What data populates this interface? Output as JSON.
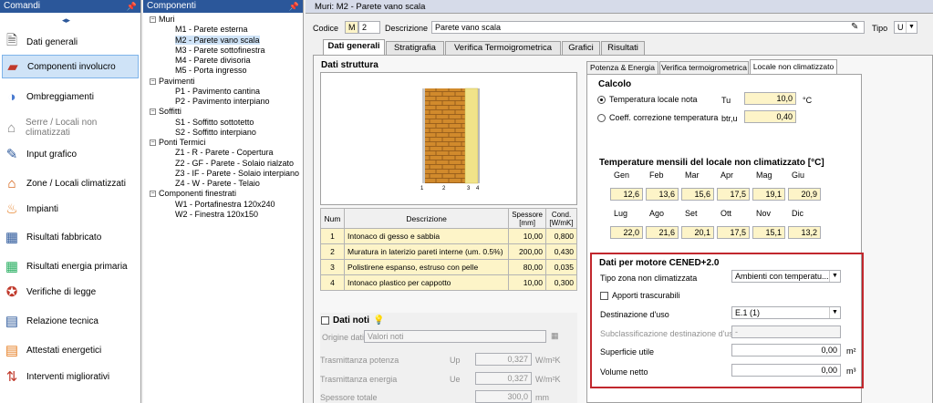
{
  "left": {
    "title": "Comandi",
    "items": [
      {
        "label": "Dati generali",
        "icon": "document-icon"
      },
      {
        "label": "Componenti involucro",
        "icon": "wall-icon"
      },
      {
        "label": "Ombreggiamenti",
        "icon": "shade-icon"
      },
      {
        "label": "Serre / Locali non climatizzati",
        "icon": "greenhouse-icon"
      },
      {
        "label": "Input grafico",
        "icon": "graph-icon"
      },
      {
        "label": "Zone / Locali climatizzati",
        "icon": "house-icon"
      },
      {
        "label": "Impianti",
        "icon": "flame-icon"
      },
      {
        "label": "Risultati fabbricato",
        "icon": "calculator-icon"
      },
      {
        "label": "Risultati energia primaria",
        "icon": "calculator-green-icon"
      },
      {
        "label": "Verifiche di legge",
        "icon": "star-icon"
      },
      {
        "label": "Relazione tecnica",
        "icon": "report-icon"
      },
      {
        "label": "Attestati energetici",
        "icon": "energy-bars-icon"
      },
      {
        "label": "Interventi migliorativi",
        "icon": "improve-icon"
      }
    ]
  },
  "tree": {
    "title": "Componenti",
    "nodes": [
      {
        "label": "Muri",
        "level": 0
      },
      {
        "label": "M1 - Parete esterna",
        "level": 1
      },
      {
        "label": "M2 - Parete vano scala",
        "level": 1
      },
      {
        "label": "M3 - Parete sottofinestra",
        "level": 1
      },
      {
        "label": "M4 - Parete divisoria",
        "level": 1
      },
      {
        "label": "M5 - Porta ingresso",
        "level": 1
      },
      {
        "label": "Pavimenti",
        "level": 0
      },
      {
        "label": "P1 - Pavimento cantina",
        "level": 1
      },
      {
        "label": "P2 - Pavimento interpiano",
        "level": 1
      },
      {
        "label": "Soffitti",
        "level": 0
      },
      {
        "label": "S1 - Soffitto sottotetto",
        "level": 1
      },
      {
        "label": "S2 - Soffitto interpiano",
        "level": 1
      },
      {
        "label": "Ponti Termici",
        "level": 0
      },
      {
        "label": "Z1 - R  - Parete - Copertura",
        "level": 1
      },
      {
        "label": "Z2 - GF - Parete - Solaio rialzato",
        "level": 1
      },
      {
        "label": "Z3 - IF - Parete - Solaio interpiano",
        "level": 1
      },
      {
        "label": "Z4 - W  - Parete - Telaio",
        "level": 1
      },
      {
        "label": "Componenti finestrati",
        "level": 0
      },
      {
        "label": "W1 - Portafinestra 120x240",
        "level": 1
      },
      {
        "label": "W2 - Finestra 120x150",
        "level": 1
      }
    ]
  },
  "main": {
    "title": "Muri: M2 - Parete vano scala",
    "codice_label": "Codice",
    "codice_prefix": "M",
    "codice_value": "2",
    "descr_label": "Descrizione",
    "descr_value": "Parete vano scala",
    "tipo_label": "Tipo",
    "tipo_value": "U",
    "tabs": [
      "Dati generali",
      "Stratigrafia",
      "Verifica Termoigrometrica",
      "Grafici",
      "Risultati"
    ],
    "dati_struttura": "Dati struttura",
    "layer_marks": [
      "1",
      "2",
      "3",
      "4"
    ],
    "table_headers": [
      "Num",
      "Descrizione",
      "Spessore [mm]",
      "Cond. [W/mK]"
    ],
    "layers": [
      {
        "num": "1",
        "descr": "Intonaco di gesso e sabbia",
        "sp": "10,00",
        "cond": "0,800"
      },
      {
        "num": "2",
        "descr": "Muratura in laterizio pareti interne (um. 0.5%)",
        "sp": "200,00",
        "cond": "0,430"
      },
      {
        "num": "3",
        "descr": "Polistirene espanso, estruso con pelle",
        "sp": "80,00",
        "cond": "0,035"
      },
      {
        "num": "4",
        "descr": "Intonaco plastico per cappotto",
        "sp": "10,00",
        "cond": "0,300"
      }
    ],
    "dati_noti": "Dati noti",
    "origine_label": "Origine dati",
    "origine_value": "Valori noti",
    "tr_pot_label": "Trasmittanza potenza",
    "tr_pot_sym": "Up",
    "tr_pot_val": "0,327",
    "tr_pot_unit": "W/m²K",
    "tr_en_label": "Trasmittanza energia",
    "tr_en_sym": "Ue",
    "tr_en_val": "0,327",
    "tr_en_unit": "W/m²K",
    "sp_label": "Spessore totale",
    "sp_val": "300,0",
    "sp_unit": "mm"
  },
  "right": {
    "subtabs": [
      "Potenza & Energia",
      "Verifica termoigrometrica",
      "Locale non climatizzato"
    ],
    "calcolo": "Calcolo",
    "radio1": "Temperatura locale nota",
    "radio1_sym": "Tu",
    "radio1_val": "10,0",
    "radio1_unit": "°C",
    "radio2": "Coeff. correzione temperatura",
    "radio2_sym": "btr,u",
    "radio2_val": "0,40",
    "temp_title": "Temperature mensili del locale non climatizzato [°C]",
    "months1": [
      "Gen",
      "Feb",
      "Mar",
      "Apr",
      "Mag",
      "Giu"
    ],
    "vals1": [
      "12,6",
      "13,6",
      "15,6",
      "17,5",
      "19,1",
      "20,9"
    ],
    "months2": [
      "Lug",
      "Ago",
      "Set",
      "Ott",
      "Nov",
      "Dic"
    ],
    "vals2": [
      "22,0",
      "21,6",
      "20,1",
      "17,5",
      "15,1",
      "13,2"
    ],
    "cened_title": "Dati per motore CENED+2.0",
    "tipo_zona_label": "Tipo zona non climatizzata",
    "tipo_zona_val": "Ambienti con temperatu...",
    "apporti": "Apporti trascurabili",
    "dest_label": "Destinazione d'uso",
    "dest_val": "E.1 (1)",
    "subcl_label": "Subclassificazione destinazione d'uso",
    "subcl_val": "-",
    "sup_label": "Superficie utile",
    "sup_val": "0,00",
    "sup_unit": "m²",
    "vol_label": "Volume netto",
    "vol_val": "0,00",
    "vol_unit": "m³"
  }
}
